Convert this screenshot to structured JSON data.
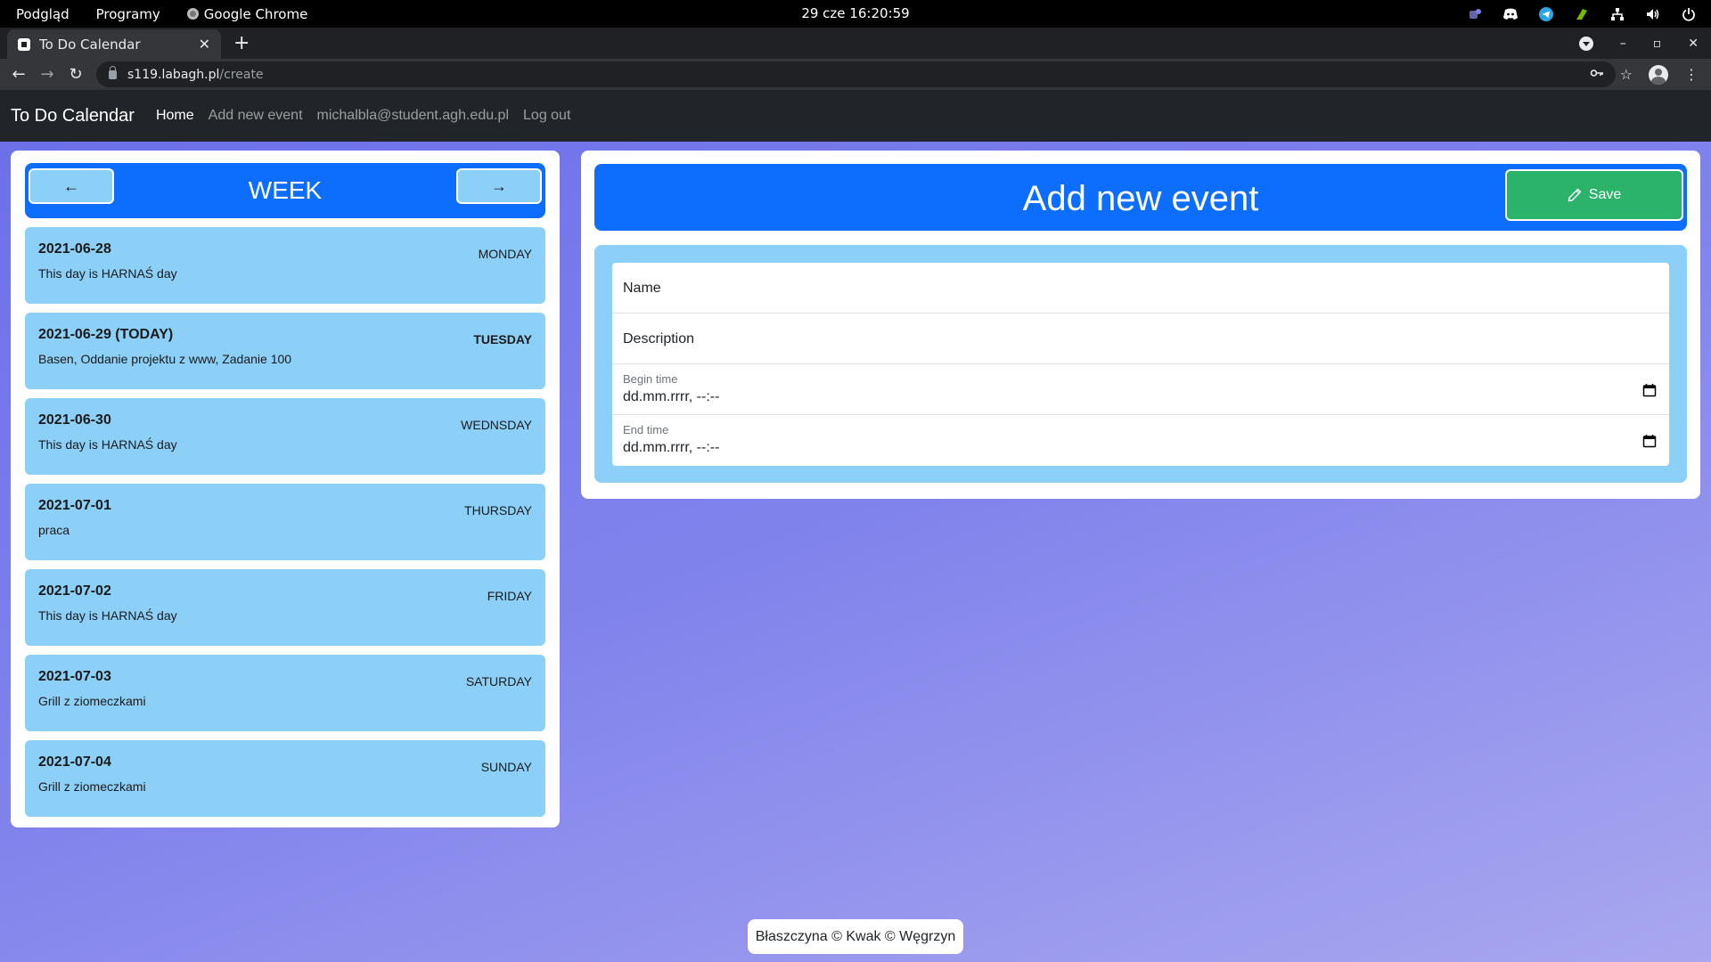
{
  "os_bar": {
    "menu_preview": "Podgląd",
    "menu_programs": "Programy",
    "active_app": "Google Chrome",
    "clock": "29 cze  16:20:59"
  },
  "browser": {
    "tab_title": "To Do Calendar",
    "url_host": "s119.labagh.pl",
    "url_path": "/create"
  },
  "navbar": {
    "brand": "To Do Calendar",
    "links": [
      "Home",
      "Add new event",
      "michalbla@student.agh.edu.pl",
      "Log out"
    ],
    "active_link": "Home"
  },
  "week": {
    "title": "WEEK",
    "prev_label": "←",
    "next_label": "→",
    "days": [
      {
        "date": "2021-06-28",
        "day": "MONDAY",
        "events": "This day is HARNAŚ day",
        "today": false
      },
      {
        "date": "2021-06-29 (TODAY)",
        "day": "TUESDAY",
        "events": "Basen, Oddanie projektu z www, Zadanie 100",
        "today": true
      },
      {
        "date": "2021-06-30",
        "day": "WEDNSDAY",
        "events": "This day is HARNAŚ day",
        "today": false
      },
      {
        "date": "2021-07-01",
        "day": "THURSDAY",
        "events": "praca",
        "today": false
      },
      {
        "date": "2021-07-02",
        "day": "FRIDAY",
        "events": "This day is HARNAŚ day",
        "today": false
      },
      {
        "date": "2021-07-03",
        "day": "SATURDAY",
        "events": "Grill z ziomeczkami",
        "today": false
      },
      {
        "date": "2021-07-04",
        "day": "SUNDAY",
        "events": "Grill z ziomeczkami",
        "today": false
      }
    ]
  },
  "event_form": {
    "title": "Add new event",
    "save_label": "Save",
    "name_placeholder": "Name",
    "description_placeholder": "Description",
    "begin_label": "Begin time",
    "begin_value": "dd.mm.rrrr, --:--",
    "end_label": "End time",
    "end_value": "dd.mm.rrrr, --:--"
  },
  "footer": "Błaszczyna © Kwak © Węgrzyn",
  "colors": {
    "primary": "#0d6efd",
    "card_blue": "#8ccff7",
    "save_green": "#2bb36a",
    "navbar_dark": "#212529"
  }
}
